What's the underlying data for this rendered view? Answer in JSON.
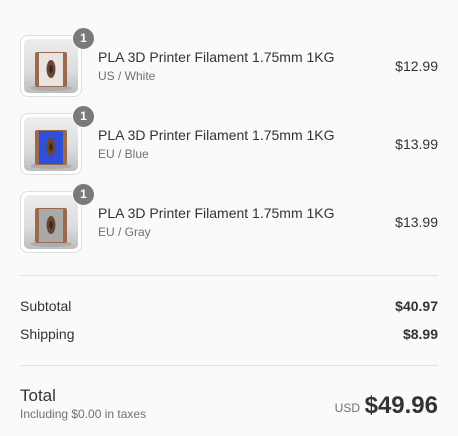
{
  "line_items": [
    {
      "quantity": "1",
      "title": "PLA 3D Printer Filament 1.75mm 1KG",
      "variant": "US / White",
      "price": "$12.99",
      "filament_color": "#e8e4df",
      "image_icon": "filament-spool-icon"
    },
    {
      "quantity": "1",
      "title": "PLA 3D Printer Filament 1.75mm 1KG",
      "variant": "EU / Blue",
      "price": "$13.99",
      "filament_color": "#2f4fd8",
      "image_icon": "filament-spool-icon"
    },
    {
      "quantity": "1",
      "title": "PLA 3D Printer Filament 1.75mm 1KG",
      "variant": "EU / Gray",
      "price": "$13.99",
      "filament_color": "#a9aaa8",
      "image_icon": "filament-spool-icon"
    }
  ],
  "subtotal": {
    "label": "Subtotal",
    "value": "$40.97"
  },
  "shipping": {
    "label": "Shipping",
    "value": "$8.99"
  },
  "total": {
    "label": "Total",
    "tax_note": "Including $0.00 in taxes",
    "currency": "USD",
    "amount": "$49.96"
  },
  "colors": {
    "badge": "#7a7a7a",
    "spool": "#9a6a4f",
    "divider": "#e1e1e1"
  }
}
